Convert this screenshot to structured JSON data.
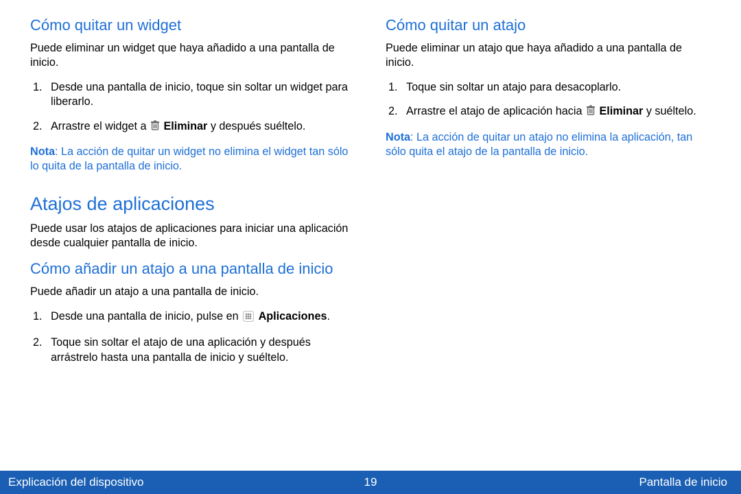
{
  "left": {
    "h2_1": "Cómo quitar un widget",
    "p1": "Puede eliminar un widget que haya añadido a una pantalla de inicio.",
    "ol1": {
      "li1": "Desde una pantalla de inicio, toque sin soltar un widget para liberarlo.",
      "li2_a": "Arrastre el widget a ",
      "li2_b": " Eliminar",
      "li2_c": " y después suéltelo."
    },
    "note1_label": "Nota",
    "note1_rest": ": La acción de quitar un widget no elimina el widget tan sólo lo quita de la pantalla de inicio.",
    "h1": "Atajos de aplicaciones",
    "p2": "Puede usar los atajos de aplicaciones para iniciar una aplicación desde cualquier pantalla de inicio.",
    "h2_2": "Cómo añadir un atajo a una pantalla de inicio",
    "p3": "Puede añadir un atajo a una pantalla de inicio.",
    "ol2": {
      "li1_a": "Desde una pantalla de inicio, pulse en ",
      "li1_b": "Aplicaciones",
      "li1_c": ".",
      "li2": "Toque sin soltar el atajo de una aplicación y después arrástrelo hasta una pantalla de inicio y suéltelo."
    }
  },
  "right": {
    "h2": "Cómo quitar un atajo",
    "p1": "Puede eliminar un atajo que haya añadido a una pantalla de inicio.",
    "ol": {
      "li1": "Toque sin soltar un atajo para desacoplarlo.",
      "li2_a": "Arrastre el atajo de aplicación hacia ",
      "li2_b": " Eliminar",
      "li2_c": " y suéltelo."
    },
    "note_label": "Nota",
    "note_rest": ": La acción de quitar un atajo no elimina la aplicación, tan sólo quita el atajo de la pantalla de inicio."
  },
  "footer": {
    "left": "Explicación del dispositivo",
    "center": "19",
    "right": "Pantalla de inicio"
  }
}
